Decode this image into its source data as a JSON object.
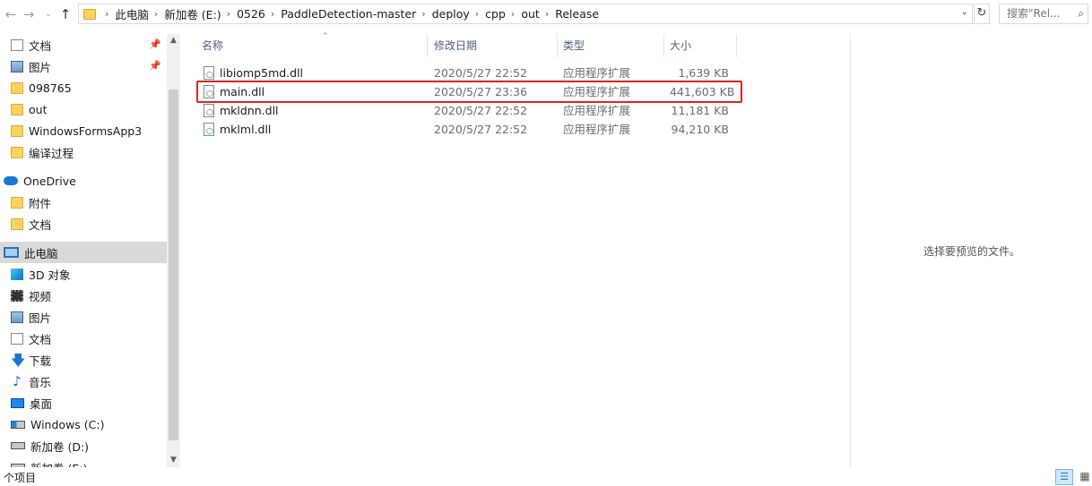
{
  "address": {
    "crumbs": [
      "此电脑",
      "新加卷 (E:)",
      "0526",
      "PaddleDetection-master",
      "deploy",
      "cpp",
      "out",
      "Release"
    ],
    "search_placeholder": "搜索\"Rel..."
  },
  "nav": {
    "items": [
      {
        "label": "文档",
        "icon": "document-icon",
        "pinned": true
      },
      {
        "label": "图片",
        "icon": "pictures-icon",
        "pinned": true
      },
      {
        "label": "098765",
        "icon": "folder-icon"
      },
      {
        "label": "out",
        "icon": "folder-icon"
      },
      {
        "label": "WindowsFormsApp3",
        "icon": "folder-icon"
      },
      {
        "label": "编译过程",
        "icon": "folder-icon"
      },
      {
        "label": "OneDrive",
        "icon": "onedrive-icon"
      },
      {
        "label": "附件",
        "icon": "folder-icon"
      },
      {
        "label": "文档",
        "icon": "folder-icon"
      },
      {
        "label": "此电脑",
        "icon": "this-pc-icon",
        "selected": true
      },
      {
        "label": "3D 对象",
        "icon": "3d-objects-icon"
      },
      {
        "label": "视频",
        "icon": "videos-icon"
      },
      {
        "label": "图片",
        "icon": "pictures-icon"
      },
      {
        "label": "文档",
        "icon": "document-icon"
      },
      {
        "label": "下载",
        "icon": "download-icon"
      },
      {
        "label": "音乐",
        "icon": "music-icon"
      },
      {
        "label": "桌面",
        "icon": "desktop-icon"
      },
      {
        "label": "Windows (C:)",
        "icon": "drive-c-icon"
      },
      {
        "label": "新加卷 (D:)",
        "icon": "drive-icon"
      },
      {
        "label": "新加卷 (E:)",
        "icon": "drive-icon"
      }
    ]
  },
  "columns": {
    "name": "名称",
    "date": "修改日期",
    "type": "类型",
    "size": "大小"
  },
  "files": [
    {
      "name": "libiomp5md.dll",
      "date": "2020/5/27 22:52",
      "type": "应用程序扩展",
      "size": "1,639 KB"
    },
    {
      "name": "main.dll",
      "date": "2020/5/27 23:36",
      "type": "应用程序扩展",
      "size": "441,603 KB",
      "highlighted": true
    },
    {
      "name": "mkldnn.dll",
      "date": "2020/5/27 22:52",
      "type": "应用程序扩展",
      "size": "11,181 KB"
    },
    {
      "name": "mklml.dll",
      "date": "2020/5/27 22:52",
      "type": "应用程序扩展",
      "size": "94,210 KB"
    }
  ],
  "preview": {
    "message": "选择要预览的文件。"
  },
  "status": {
    "item_count": "个项目"
  },
  "colors": {
    "highlight_border": "#e32222",
    "selected_nav": "#d9d9d9",
    "view_button_active": "#cce8ff"
  }
}
